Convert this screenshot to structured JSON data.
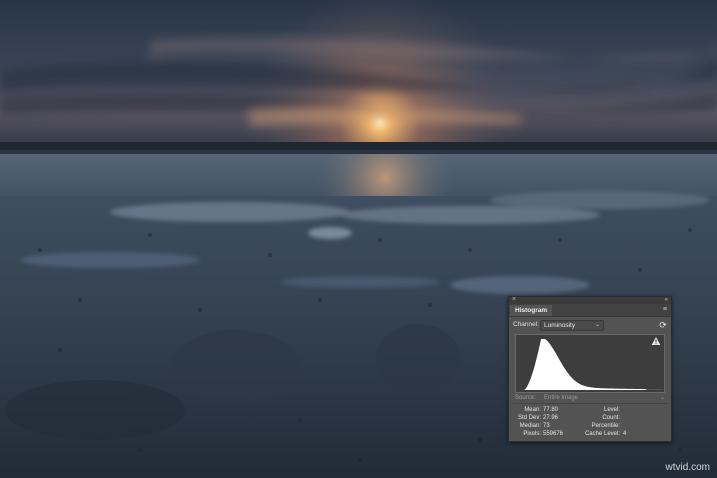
{
  "histogram_panel": {
    "close_glyph": "×",
    "collapse_glyph": "«",
    "tab_label": "Histogram",
    "menu_icon": "menu-icon",
    "channel_label": "Channel:",
    "channel_value": "Luminosity",
    "refresh_icon": "refresh-icon",
    "warning_icon": "warning-icon",
    "source_label": "Source:",
    "source_value": "Entire Image",
    "stats_left": [
      {
        "label": "Mean:",
        "value": "77.80"
      },
      {
        "label": "Std Dev:",
        "value": "27.96"
      },
      {
        "label": "Median:",
        "value": "73"
      },
      {
        "label": "Pixels:",
        "value": "559676"
      }
    ],
    "stats_right": [
      {
        "label": "Level:",
        "value": ""
      },
      {
        "label": "Count:",
        "value": ""
      },
      {
        "label": "Percentile:",
        "value": ""
      },
      {
        "label": "Cache Level:",
        "value": "4"
      }
    ],
    "histogram_peak_level": 42,
    "histogram_color": "#ffffff",
    "histogram_bg": "#3d3d3d"
  },
  "watermark": "wtvid.com"
}
